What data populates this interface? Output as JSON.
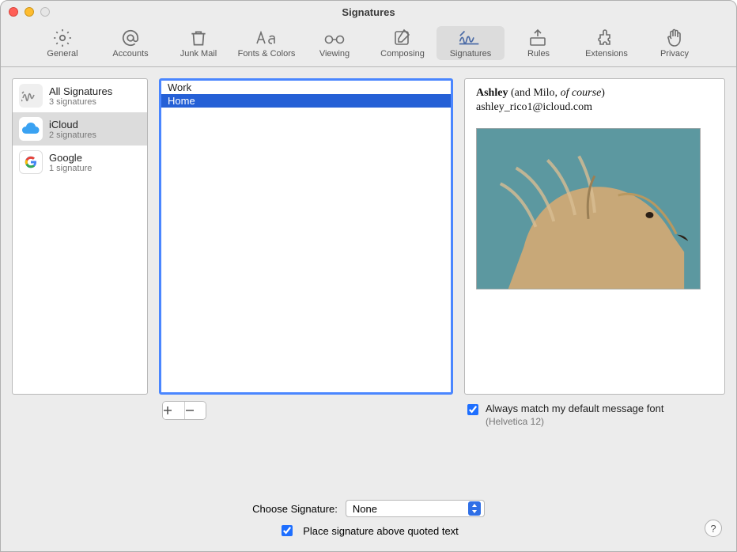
{
  "window": {
    "title": "Signatures"
  },
  "toolbar": {
    "items": [
      {
        "label": "General"
      },
      {
        "label": "Accounts"
      },
      {
        "label": "Junk Mail"
      },
      {
        "label": "Fonts & Colors"
      },
      {
        "label": "Viewing"
      },
      {
        "label": "Composing"
      },
      {
        "label": "Signatures"
      },
      {
        "label": "Rules"
      },
      {
        "label": "Extensions"
      },
      {
        "label": "Privacy"
      }
    ]
  },
  "accounts": [
    {
      "name": "All Signatures",
      "sub": "3 signatures"
    },
    {
      "name": "iCloud",
      "sub": "2 signatures"
    },
    {
      "name": "Google",
      "sub": "1 signature"
    }
  ],
  "signatures": [
    {
      "name": "Work"
    },
    {
      "name": "Home"
    }
  ],
  "preview": {
    "name": "Ashley",
    "paren_pre": " (and Milo, ",
    "paren_it": "of course",
    "paren_post": ")",
    "email": "ashley_rico1@icloud.com",
    "img_alt": "dog-photo"
  },
  "matchFont": {
    "label": "Always match my default message font",
    "sub": "(Helvetica 12)",
    "checked": true
  },
  "choose": {
    "label": "Choose Signature:",
    "value": "None"
  },
  "place": {
    "label": "Place signature above quoted text",
    "checked": true
  },
  "help": "?"
}
